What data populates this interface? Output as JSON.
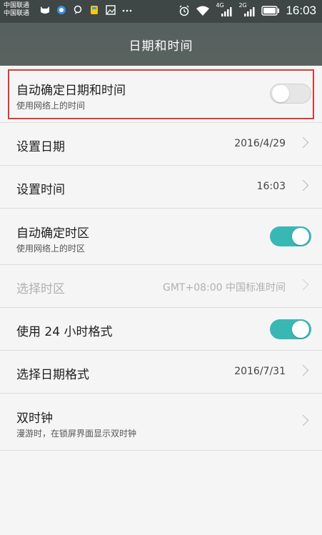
{
  "status_bar": {
    "carrier_1": "中国联通",
    "carrier_2": "中国联通",
    "network_1": "4G",
    "network_2": "2G",
    "time": "16:03",
    "icons": [
      "cat-icon",
      "bluetooth-icon",
      "chat-icon",
      "app-icon",
      "image-icon",
      "more-icon",
      "alarm-icon",
      "wifi-icon",
      "signal-icon",
      "signal-icon",
      "battery-icon"
    ]
  },
  "header": {
    "title": "日期和时间"
  },
  "settings": {
    "auto_datetime": {
      "label": "自动确定日期和时间",
      "sub": "使用网络上的时间",
      "enabled": false
    },
    "set_date": {
      "label": "设置日期",
      "value": "2016/4/29"
    },
    "set_time": {
      "label": "设置时间",
      "value": "16:03"
    },
    "auto_timezone": {
      "label": "自动确定时区",
      "sub": "使用网络上的时区",
      "enabled": true
    },
    "select_timezone": {
      "label": "选择时区",
      "value": "GMT+08:00 中国标准时间"
    },
    "use_24h": {
      "label": "使用 24 小时格式",
      "enabled": true
    },
    "date_format": {
      "label": "选择日期格式",
      "value": "2016/7/31"
    },
    "dual_clock": {
      "label": "双时钟",
      "sub": "漫游时，在锁屏界面显示双时钟"
    }
  },
  "colors": {
    "accent": "#39b7b5",
    "highlight": "#d9383a",
    "header": "#58615f"
  }
}
